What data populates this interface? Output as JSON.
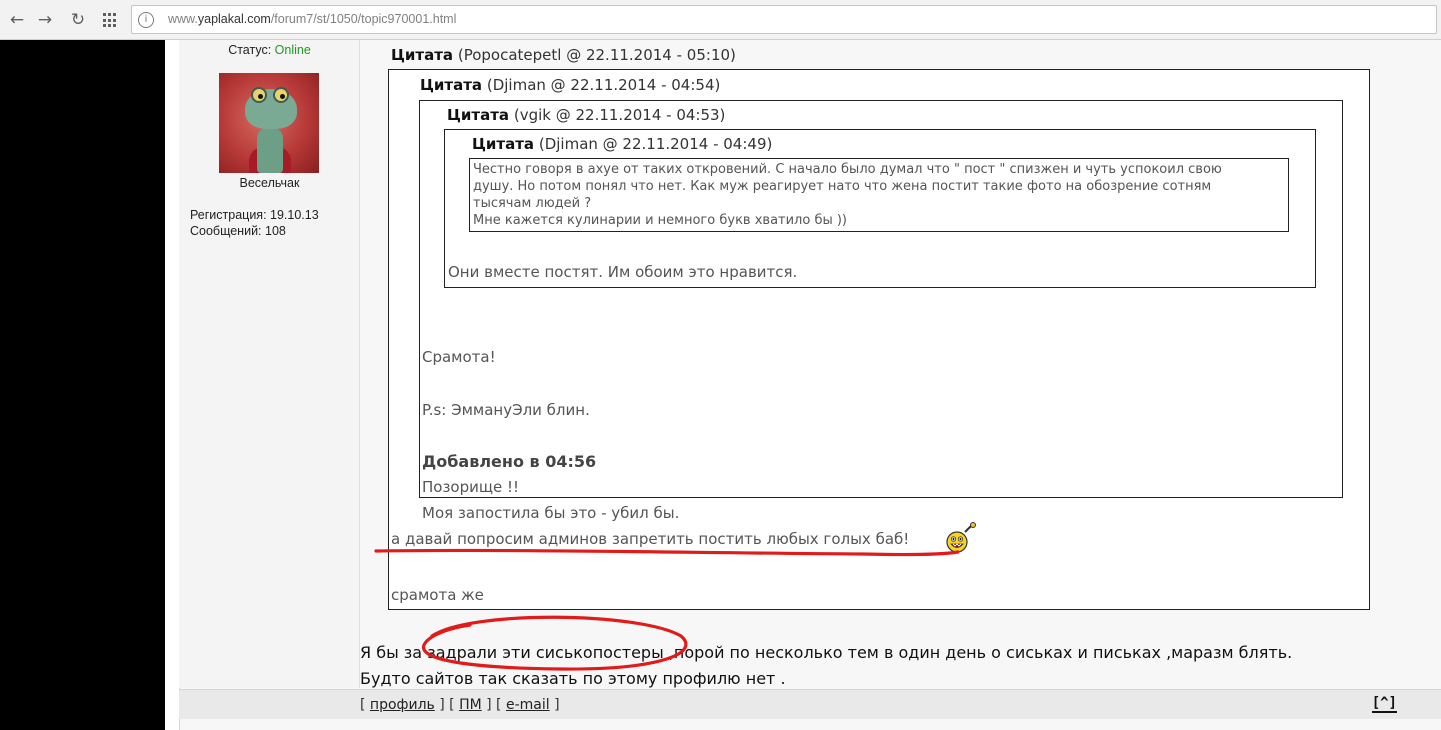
{
  "browser": {
    "url_prefix": "www.",
    "url_host": "yaplakal.com",
    "url_path": "/forum7/st/1050/topic970001.html"
  },
  "user": {
    "status_label": "Статус:",
    "status_value": "Online",
    "rank": "Весельчак",
    "registration": "Регистрация: 19.10.13",
    "messages": "Сообщений: 108"
  },
  "quotes": {
    "label": "Цитата",
    "q1_meta": "(Popocatepetl @ 22.11.2014 - 05:10)",
    "q2_meta": "(Djiman @ 22.11.2014 - 04:54)",
    "q3_meta": "(vgik @ 22.11.2014 - 04:53)",
    "q4_meta": "(Djiman @ 22.11.2014 - 04:49)",
    "q4_lines": [
      "Честно говоря в ахуе от таких откровений. С начало было думал что \" пост \" спизжен и чуть успокоил свою",
      "душу. Но потом понял что нет. Как муж реагирует нато что жена постит такие фото на обозрение сотням",
      "тысячам людей ?",
      "Мне кажется кулинарии и немного букв хватило бы ))"
    ],
    "q3_reply": "Они вместе постят. Им обоим это нравится.",
    "q2_lines": [
      "Срамота!",
      "P.s: ЭммануЭли блин.",
      "Добавлено в 04:56",
      "Позорище !!",
      "Моя запостила бы это - убил бы."
    ],
    "q1_lines": [
      "а давай попросим админов запретить постить любых голых баб!",
      "срамота же"
    ]
  },
  "post": {
    "lines": [
      "Я бы за  задрали эти сиськопостеры ,порой по несколько тем в один день о сиськах и письках ,маразм блять.",
      "Будто сайтов так сказать по этому профилю нет ."
    ]
  },
  "footer": {
    "profile": "профиль",
    "pm": "ПМ",
    "email": "e-mail",
    "top": "[^]"
  },
  "colors": {
    "annotation": "#e11a1a",
    "online": "#1f9a1f"
  }
}
